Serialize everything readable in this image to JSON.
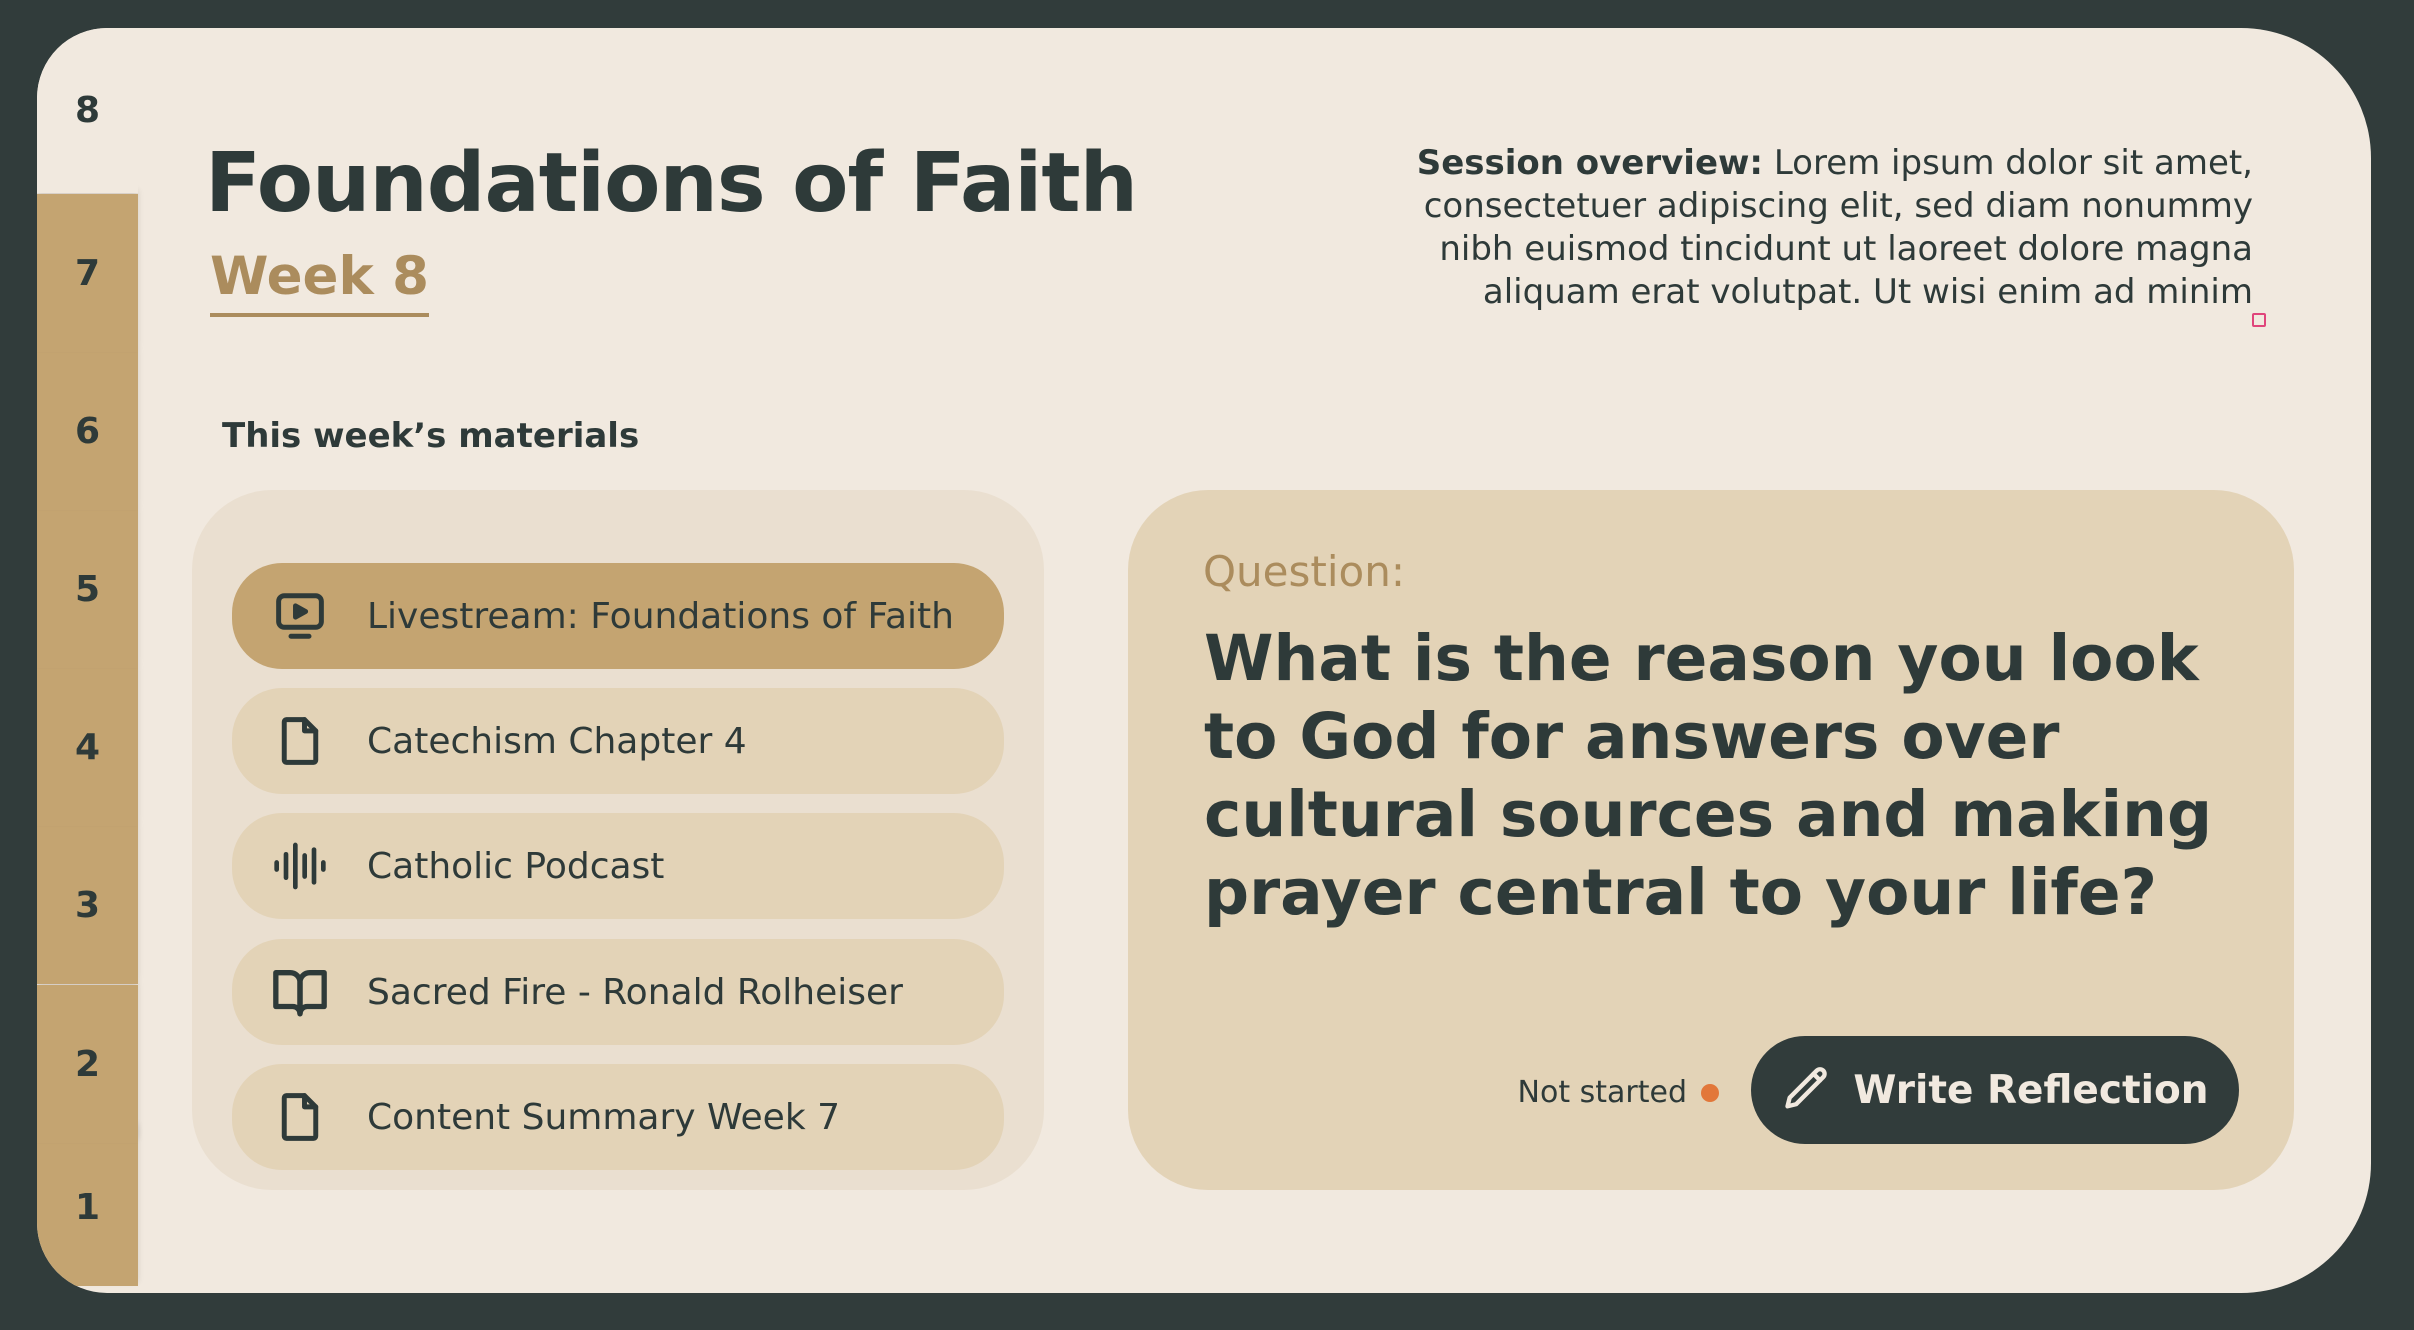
{
  "sidebar": {
    "tabs": [
      {
        "label": "8",
        "active": true
      },
      {
        "label": "7"
      },
      {
        "label": "6"
      },
      {
        "label": "5"
      },
      {
        "label": "4"
      },
      {
        "label": "3"
      },
      {
        "label": "2"
      },
      {
        "label": "1"
      }
    ]
  },
  "header": {
    "title": "Foundations of Faith",
    "week": "Week 8",
    "overview_label": "Session overview:",
    "overview_text": " Lorem ipsum dolor sit amet, consectetuer adipiscing elit, sed diam nonummy nibh euismod tincidunt ut laoreet dolore magna aliquam erat volutpat. Ut wisi enim ad minim"
  },
  "materials": {
    "heading": "This week’s materials",
    "items": [
      {
        "label": "Livestream: Foundations of Faith",
        "icon": "video-icon",
        "active": true
      },
      {
        "label": "Catechism Chapter 4",
        "icon": "document-icon"
      },
      {
        "label": "Catholic Podcast",
        "icon": "audio-waveform-icon"
      },
      {
        "label": "Sacred Fire - Ronald Rolheiser",
        "icon": "book-icon"
      },
      {
        "label": "Content Summary Week 7",
        "icon": "document-icon"
      }
    ]
  },
  "question": {
    "label": "Question:",
    "text": "What is the reason you look to God for answers over cultural sources and making prayer central to your life?",
    "status": "Not started",
    "status_color": "#e2773a",
    "button_label": "Write Reflection",
    "button_icon": "pencil-icon"
  },
  "colors": {
    "background": "#313c3b",
    "card": "#f1e9df",
    "accent": "#c4a471",
    "accent_text": "#ab8c5d",
    "panel": "#e3d3b7",
    "text": "#2e3a39"
  }
}
